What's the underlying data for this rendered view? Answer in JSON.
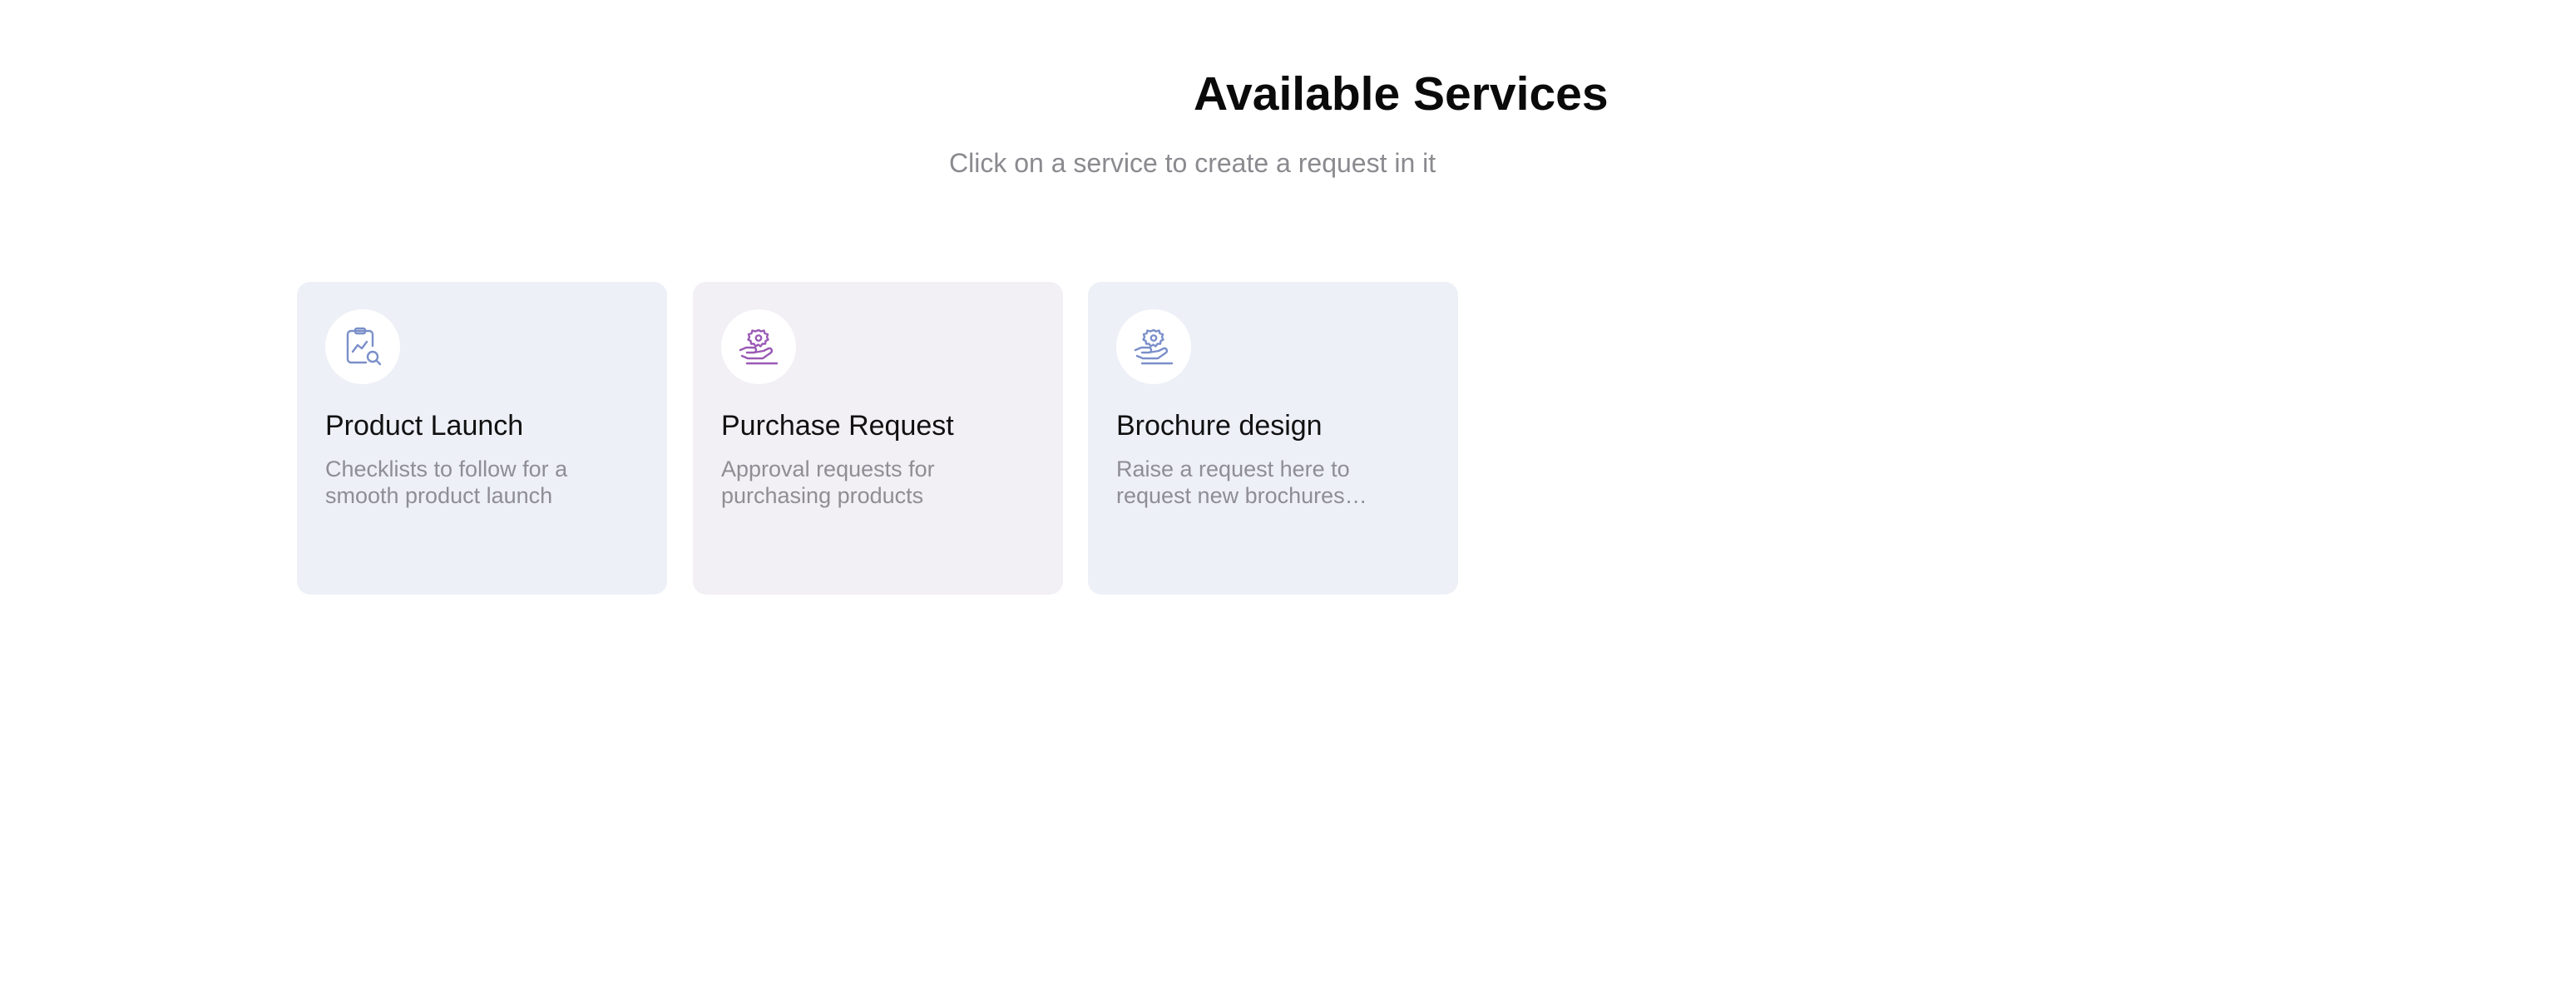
{
  "header": {
    "title": "Available Services",
    "subtitle": "Click on a service to create a request in it"
  },
  "services": [
    {
      "title": "Product Launch",
      "description": "Checklists to follow for a smooth product launch",
      "icon": "clipboard-chart-search-icon",
      "card_color": "#edf0f7",
      "icon_color": "#7b8fc9"
    },
    {
      "title": "Purchase Request",
      "description": "Approval requests for purchasing products",
      "icon": "hand-gear-icon",
      "card_color": "#f2eff5",
      "icon_color": "#9a59b5"
    },
    {
      "title": "Brochure design",
      "description": "Raise a request here to request new brochures for…",
      "icon": "hand-gear-icon",
      "card_color": "#edf0f7",
      "icon_color": "#7b8fc9"
    }
  ]
}
